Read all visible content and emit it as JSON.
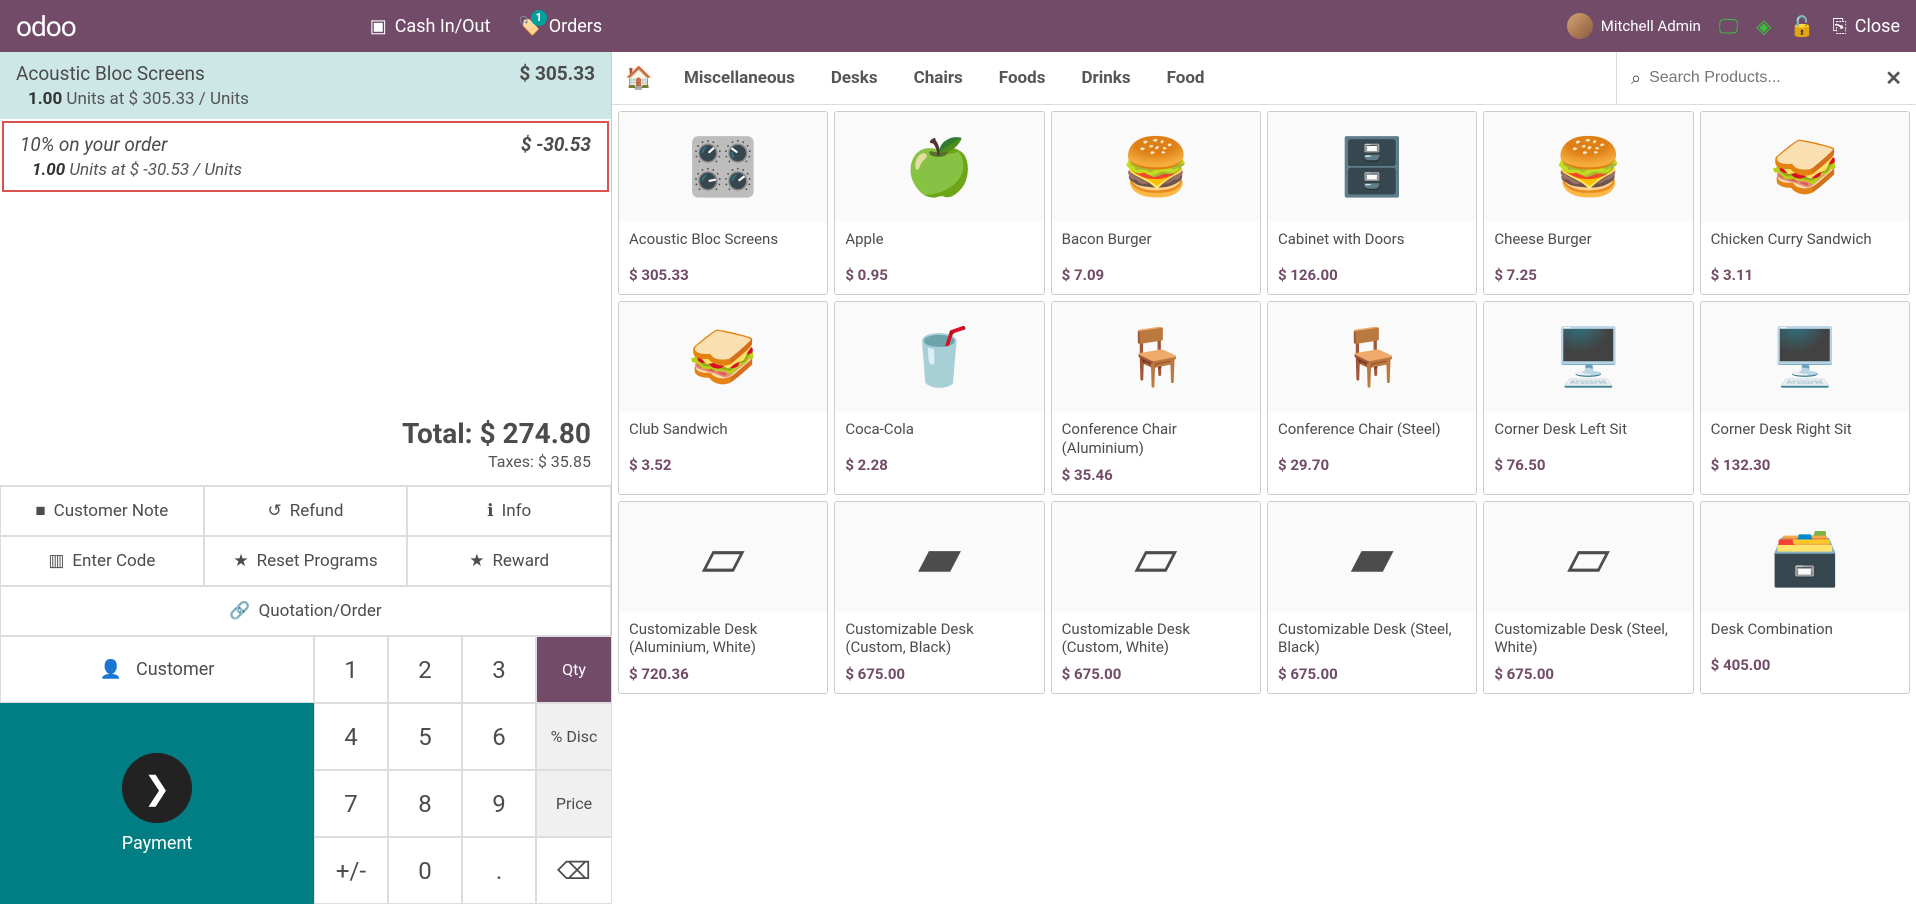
{
  "topbar": {
    "logo": "odoo",
    "cash": "Cash In/Out",
    "orders": "Orders",
    "orders_badge": "1",
    "user": "Mitchell Admin",
    "close": "Close"
  },
  "order": {
    "lines": [
      {
        "name": "Acoustic Bloc Screens",
        "price": "$ 305.33",
        "qty": "1.00",
        "unit_price": "$ 305.33",
        "unit": "Units",
        "sel": "a"
      },
      {
        "name": "10% on your order",
        "price": "$ -30.53",
        "qty": "1.00",
        "unit_price": "$ -30.53",
        "unit": "Units",
        "sel": "b"
      }
    ],
    "total_label": "Total:",
    "total": "$ 274.80",
    "taxes_label": "Taxes:",
    "taxes": "$ 35.85"
  },
  "actions": {
    "customer_note": "Customer Note",
    "refund": "Refund",
    "info": "Info",
    "enter_code": "Enter Code",
    "reset_programs": "Reset Programs",
    "reward": "Reward",
    "quotation": "Quotation/Order",
    "customer": "Customer",
    "payment": "Payment"
  },
  "pad": {
    "n1": "1",
    "n2": "2",
    "n3": "3",
    "n4": "4",
    "n5": "5",
    "n6": "6",
    "n7": "7",
    "n8": "8",
    "n9": "9",
    "n0": "0",
    "pm": "+/-",
    "dot": ".",
    "qty": "Qty",
    "disc": "% Disc",
    "price": "Price",
    "back": "⌫"
  },
  "categories": {
    "misc": "Miscellaneous",
    "desks": "Desks",
    "chairs": "Chairs",
    "foods": "Foods",
    "drinks": "Drinks",
    "food": "Food"
  },
  "search": {
    "placeholder": "Search Products..."
  },
  "products": [
    {
      "name": "Acoustic Bloc Screens",
      "price": "$ 305.33",
      "emoji": "🎛️"
    },
    {
      "name": "Apple",
      "price": "$ 0.95",
      "emoji": "🍏"
    },
    {
      "name": "Bacon Burger",
      "price": "$ 7.09",
      "emoji": "🍔"
    },
    {
      "name": "Cabinet with Doors",
      "price": "$ 126.00",
      "emoji": "🗄️"
    },
    {
      "name": "Cheese Burger",
      "price": "$ 7.25",
      "emoji": "🍔"
    },
    {
      "name": "Chicken Curry Sandwich",
      "price": "$ 3.11",
      "emoji": "🥪"
    },
    {
      "name": "Club Sandwich",
      "price": "$ 3.52",
      "emoji": "🥪"
    },
    {
      "name": "Coca-Cola",
      "price": "$ 2.28",
      "emoji": "🥤"
    },
    {
      "name": "Conference Chair (Aluminium)",
      "price": "$ 35.46",
      "emoji": "🪑"
    },
    {
      "name": "Conference Chair (Steel)",
      "price": "$ 29.70",
      "emoji": "🪑"
    },
    {
      "name": "Corner Desk Left Sit",
      "price": "$ 76.50",
      "emoji": "🖥️"
    },
    {
      "name": "Corner Desk Right Sit",
      "price": "$ 132.30",
      "emoji": "🖥️"
    },
    {
      "name": "Customizable Desk (Aluminium, White)",
      "price": "$ 720.36",
      "emoji": "▱"
    },
    {
      "name": "Customizable Desk (Custom, Black)",
      "price": "$ 675.00",
      "emoji": "▰"
    },
    {
      "name": "Customizable Desk (Custom, White)",
      "price": "$ 675.00",
      "emoji": "▱"
    },
    {
      "name": "Customizable Desk (Steel, Black)",
      "price": "$ 675.00",
      "emoji": "▰"
    },
    {
      "name": "Customizable Desk (Steel, White)",
      "price": "$ 675.00",
      "emoji": "▱"
    },
    {
      "name": "Desk Combination",
      "price": "$ 405.00",
      "emoji": "🗃️"
    }
  ]
}
